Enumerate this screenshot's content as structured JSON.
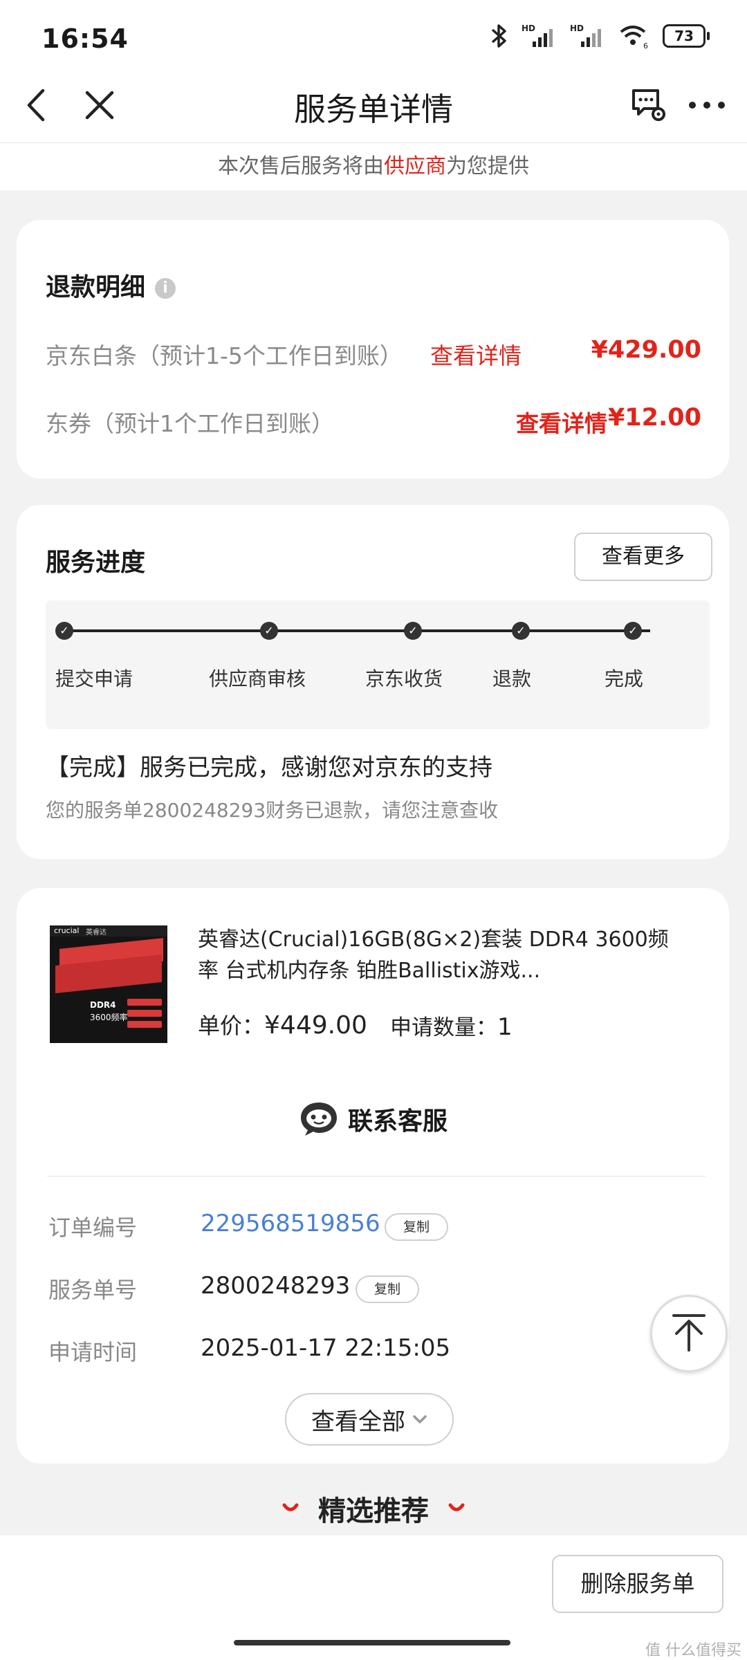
{
  "status_bar": {
    "time": "16:54",
    "battery": "73",
    "wifi_sub": "6"
  },
  "nav": {
    "title": "服务单详情"
  },
  "banner": {
    "prefix": "本次售后服务将由",
    "highlight": "供应商",
    "suffix": "为您提供"
  },
  "refund": {
    "title": "退款明细",
    "rows": [
      {
        "label": "京东白条（预计1-5个工作日到账）",
        "link": "查看详情",
        "amount": "¥429.00"
      },
      {
        "label": "东券（预计1个工作日到账）",
        "link": "查看详情",
        "amount": "¥12.00"
      }
    ]
  },
  "progress": {
    "title": "服务进度",
    "more_button": "查看更多",
    "steps": [
      "提交申请",
      "供应商审核",
      "京东收货",
      "退款",
      "完成"
    ],
    "status_title": "【完成】服务已完成，感谢您对京东的支持",
    "status_desc": "您的服务单2800248293财务已退款，请您注意查收"
  },
  "product": {
    "name": "英睿达(Crucial)16GB(8G×2)套装 DDR4 3600频率 台式机内存条 铂胜Ballistix游戏...",
    "price_label": "单价：",
    "price": "¥449.00",
    "qty_label": "申请数量：",
    "qty": "1",
    "image_text": {
      "brand": "crucial",
      "brand_cn": "英睿达",
      "line1": "DDR4",
      "line2": "3600频率"
    }
  },
  "contact": {
    "label": "联系客服"
  },
  "details": {
    "order_label": "订单编号",
    "order_value": "229568519856",
    "service_label": "服务单号",
    "service_value": "2800248293",
    "time_label": "申请时间",
    "time_value": "2025-01-17 22:15:05",
    "copy_label": "复制",
    "view_all": "查看全部"
  },
  "recommend": {
    "title": "精选推荐"
  },
  "bottom": {
    "delete_button": "删除服务单"
  },
  "watermark": "值 什么值得买",
  "colors": {
    "accent": "#e2231a",
    "link_blue": "#4a7fd6"
  }
}
